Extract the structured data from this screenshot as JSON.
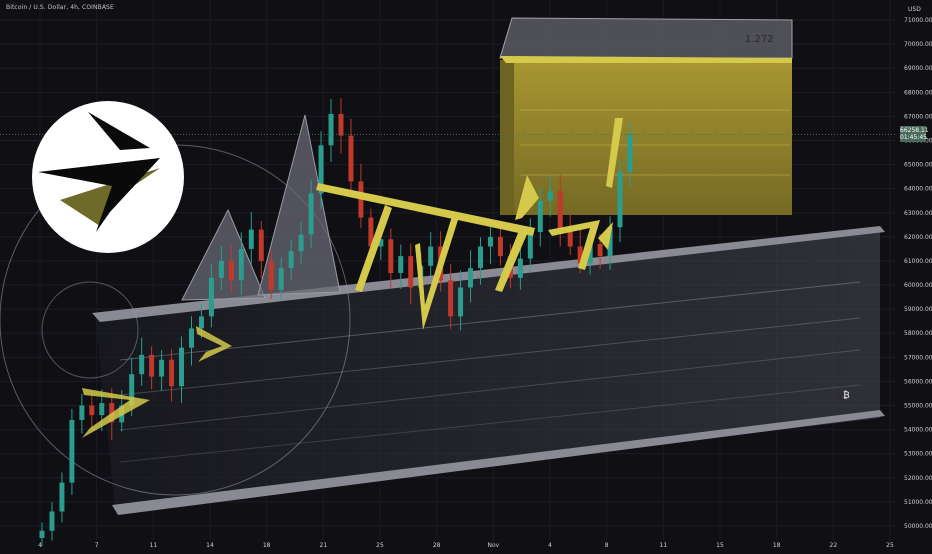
{
  "header": {
    "title": "Bitcoin / U.S. Dollar, 4h, COINBASE"
  },
  "price_axis": {
    "unit": "USD"
  },
  "current_price": {
    "value": "66258.11",
    "timer": "01:45:45"
  },
  "fib_box": {
    "label": "1.272"
  },
  "bitcoin_symbol": "₿",
  "colors": {
    "background": "#0f0f14",
    "up": "#2a9d8f",
    "down": "#c0392b",
    "pattern_yellow": "#d4c94a",
    "box_yellow": "#a08f2e",
    "channel_gray": "#6a6a72"
  },
  "chart_data": {
    "type": "candlestick",
    "title": "Bitcoin / U.S. Dollar, 4h, COINBASE",
    "ylim": [
      49500,
      71500
    ],
    "y_ticks": [
      50000,
      51000,
      52000,
      53000,
      54000,
      55000,
      56000,
      57000,
      58000,
      59000,
      60000,
      61000,
      62000,
      63000,
      64000,
      65000,
      66000,
      67000,
      68000,
      69000,
      70000,
      71000
    ],
    "x_tick_labels": [
      "4",
      "7",
      "11",
      "14",
      "18",
      "21",
      "25",
      "28",
      "Nov",
      "4",
      "8",
      "11",
      "15",
      "18",
      "22",
      "25"
    ],
    "series": [
      {
        "approx_closes": [
          49800,
          50600,
          51800,
          54400,
          55000,
          54600,
          55100,
          54300,
          55000,
          56300,
          57100,
          56200,
          56900,
          55800,
          57400,
          58200,
          58700,
          60300,
          61000,
          60200,
          61500,
          62300,
          61000,
          59800,
          60700,
          61400,
          62100,
          63800,
          65800,
          67100,
          66200,
          64300,
          62800,
          61600,
          61900,
          60500,
          61200,
          59900,
          60800,
          61600,
          60200,
          58700,
          59900,
          60700,
          61600,
          62000,
          61200,
          60300,
          61100,
          62200,
          63500,
          63900,
          62300,
          61600,
          60900,
          61700,
          61200,
          62400,
          64700,
          66250
        ]
      }
    ]
  }
}
